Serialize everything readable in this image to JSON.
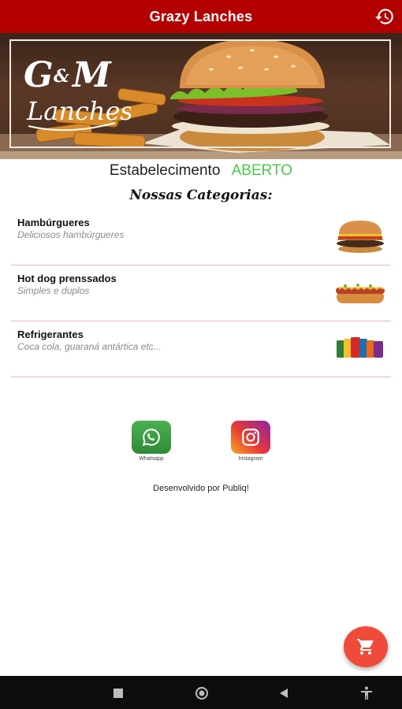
{
  "appbar": {
    "title": "Grazy Lanches",
    "history_icon": "history-icon"
  },
  "banner": {
    "logo_main": "G&M",
    "logo_sub": "Lanches"
  },
  "status": {
    "label": "Estabelecimento",
    "value": "ABERTO",
    "value_color": "#4cc94c"
  },
  "categories_title": "Nossas Categorias:",
  "categories": [
    {
      "name": "Hambúrgueres",
      "description": "Deliciosos hambúrgueres"
    },
    {
      "name": "Hot dog prenssados",
      "description": "Simples e duplos"
    },
    {
      "name": "Refrigerantes",
      "description": "Coca cola, guaraná antártica etc..."
    }
  ],
  "social": [
    {
      "label": "Whatsapp",
      "icon": "whatsapp-icon"
    },
    {
      "label": "Instagram",
      "icon": "instagram-icon"
    }
  ],
  "credit": "Desenvolvido por Publiq!",
  "fab": {
    "icon": "cart-icon"
  },
  "colors": {
    "appbar": "#b30000",
    "fab": "#f04b3a",
    "divider": "#e3b5bb"
  }
}
